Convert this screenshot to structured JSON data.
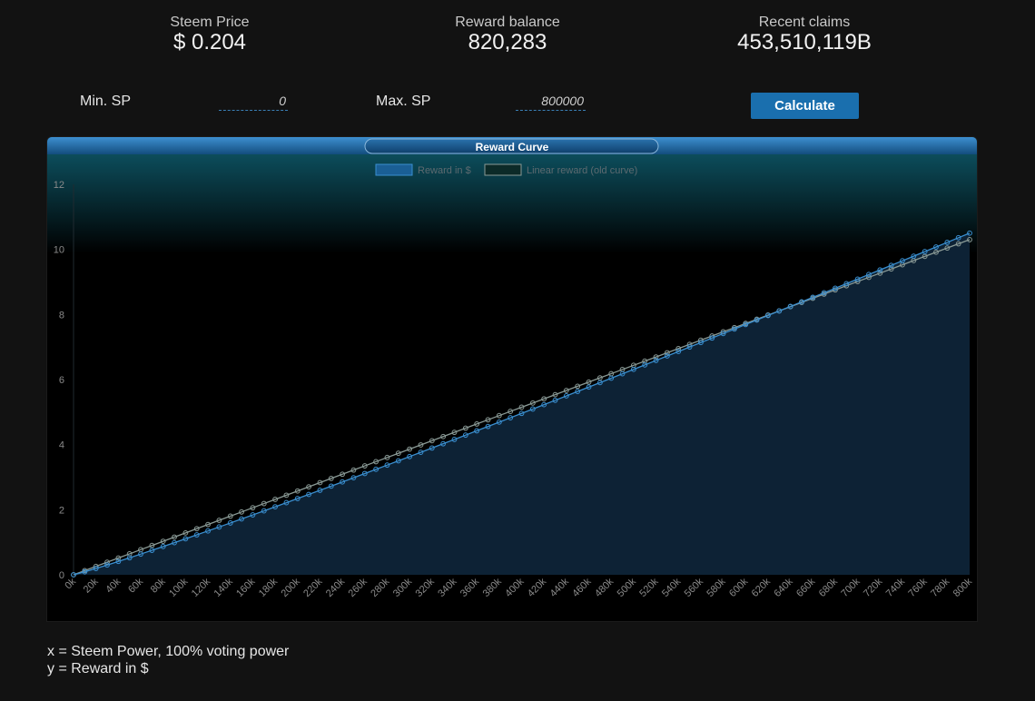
{
  "stats": {
    "price": {
      "label": "Steem Price",
      "value": "$ 0.204"
    },
    "balance": {
      "label": "Reward balance",
      "value": "820,283"
    },
    "claims": {
      "label": "Recent claims",
      "value": "453,510,119B"
    }
  },
  "form": {
    "min_label": "Min. SP",
    "min_value": "0",
    "max_label": "Max. SP",
    "max_value": "800000",
    "calculate_label": "Calculate"
  },
  "footer": {
    "x_desc": "x = Steem Power, 100% voting power",
    "y_desc": "y = Reward in $"
  },
  "colors": {
    "accent": "#1a6fae",
    "reward_series": "#3a8fd0",
    "linear_series": "#8a9a96",
    "panel_header": "#1a5f95"
  },
  "chart_data": {
    "type": "line",
    "title": "Reward Curve",
    "legend_position": "top-center",
    "grid": false,
    "ylim": [
      0,
      12
    ],
    "yticks": [
      0,
      2,
      4,
      6,
      8,
      10,
      12
    ],
    "xlim": [
      0,
      800000
    ],
    "series": [
      {
        "name": "Reward in $",
        "kind": "area",
        "x_start": 0,
        "x_step": 10000,
        "count": 81,
        "y_end": 10.5,
        "shape": 1.082
      },
      {
        "name": "Linear reward (old curve)",
        "kind": "line",
        "x_start": 0,
        "x_step": 10000,
        "count": 81,
        "y_end": 10.3,
        "shape": 1.0
      }
    ],
    "x_tick_labels": [
      "0k",
      "20k",
      "40k",
      "60k",
      "80k",
      "100k",
      "120k",
      "140k",
      "160k",
      "180k",
      "200k",
      "220k",
      "240k",
      "260k",
      "280k",
      "300k",
      "320k",
      "340k",
      "360k",
      "380k",
      "400k",
      "420k",
      "440k",
      "460k",
      "480k",
      "500k",
      "520k",
      "540k",
      "560k",
      "580k",
      "600k",
      "620k",
      "640k",
      "660k",
      "680k",
      "700k",
      "720k",
      "740k",
      "760k",
      "780k",
      "800k"
    ]
  }
}
